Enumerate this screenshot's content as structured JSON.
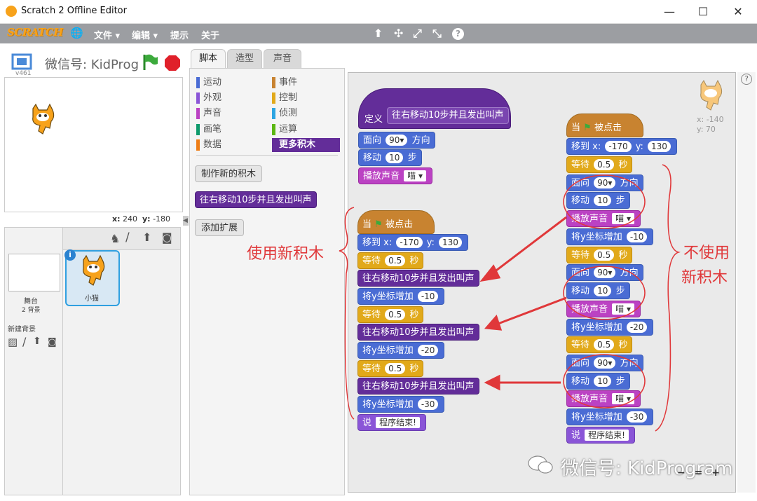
{
  "window": {
    "title": "Scratch 2 Offline Editor",
    "minimize": "—",
    "maximize": "☐",
    "close": "✕"
  },
  "menu": {
    "logo": "SCRATCH",
    "globe": "🌐",
    "items": [
      "文件 ▾",
      "编辑 ▾",
      "提示",
      "关于"
    ],
    "tools": [
      "⬆",
      "✣",
      "⤢",
      "⤡",
      "?"
    ]
  },
  "stage": {
    "version": "v461",
    "title": "微信号: KidProg",
    "x_label": "x:",
    "x_value": "240",
    "y_label": "y:",
    "y_value": "-180"
  },
  "sprites": {
    "stage_label": "舞台",
    "stage_sub": "2 背景",
    "new_backdrop": "新建背景",
    "sprite_name": "小猫"
  },
  "tabs": [
    "脚本",
    "造型",
    "声音"
  ],
  "categories": {
    "left": [
      {
        "label": "运动",
        "color": "#4a6cd4"
      },
      {
        "label": "外观",
        "color": "#8a55d7"
      },
      {
        "label": "声音",
        "color": "#bb42c3"
      },
      {
        "label": "画笔",
        "color": "#0e9a6c"
      },
      {
        "label": "数据",
        "color": "#ee7d16"
      }
    ],
    "right": [
      {
        "label": "事件",
        "color": "#c88330"
      },
      {
        "label": "控制",
        "color": "#e1a91a"
      },
      {
        "label": "侦测",
        "color": "#2ca5e2"
      },
      {
        "label": "运算",
        "color": "#5cb712"
      },
      {
        "label": "更多积木",
        "color": "#632d99"
      }
    ]
  },
  "palette": {
    "make_block": "制作新的积木",
    "custom_block": "往右移动10步并且发出叫声",
    "add_ext": "添加扩展"
  },
  "define": {
    "label": "定义",
    "name": "往右移动10步并且发出叫声"
  },
  "blocks": {
    "point": "面向",
    "dir": "90▾",
    "direction": "方向",
    "move": "移动",
    "steps_val": "10",
    "steps": "步",
    "play": "播放声音",
    "sound": "喵 ▾",
    "when": "当",
    "clicked": "被点击",
    "goto": "移到 x:",
    "gx": "-170",
    "gy_label": "y:",
    "gy": "130",
    "wait": "等待",
    "wait_val": "0.5",
    "secs": "秒",
    "custom": "往右移动10步并且发出叫声",
    "changey": "将y坐标增加",
    "cy1": "-10",
    "cy2": "-20",
    "cy3": "-30",
    "say": "说",
    "say_val": "程序结束!"
  },
  "notes": {
    "left": "使用新积木",
    "right1": "不使用",
    "right2": "新积木"
  },
  "sprite_pos": {
    "x": "x: -140",
    "y": "y: 70"
  },
  "watermark": "微信号: KidProgram",
  "zoom": {
    "minus": "−",
    "eq": "=",
    "plus": "+"
  },
  "help": "?"
}
